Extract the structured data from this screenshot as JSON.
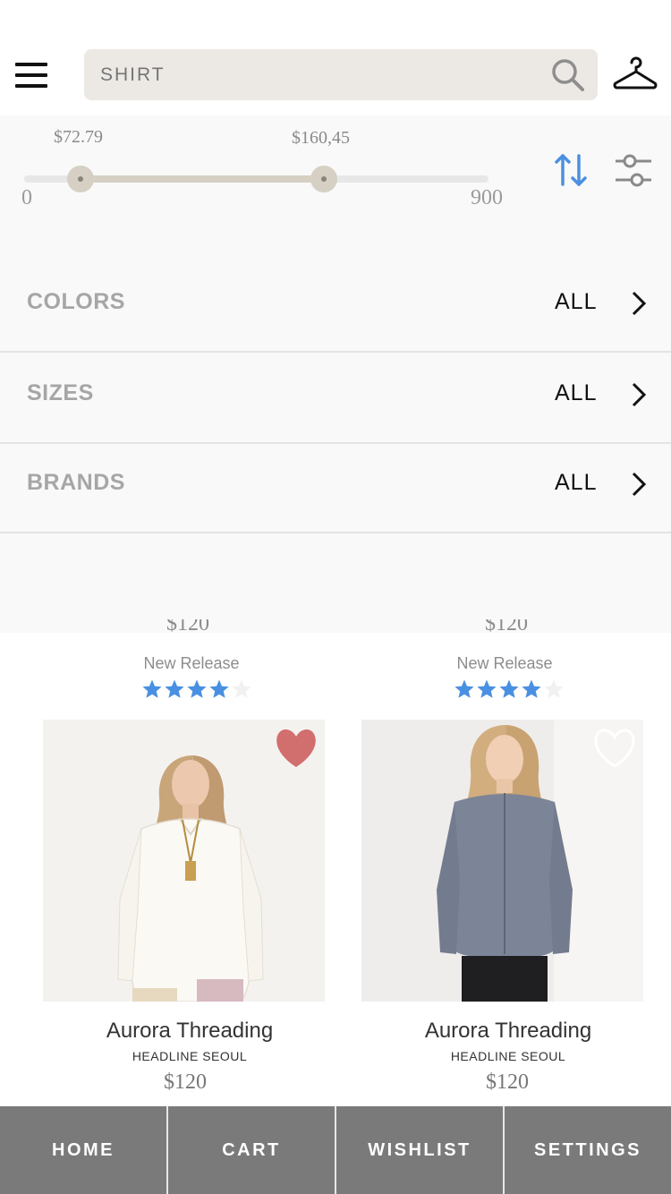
{
  "search": {
    "placeholder": "SHIRT"
  },
  "price_filter": {
    "selected_min": "$72.79",
    "selected_max": "$160,45",
    "range_min": "0",
    "range_max": "900",
    "selected_min_value": 72.79,
    "selected_max_value": 160.45,
    "range_min_value": 0,
    "range_max_value": 900
  },
  "filters": [
    {
      "label": "COLORS",
      "value": "ALL"
    },
    {
      "label": "SIZES",
      "value": "ALL"
    },
    {
      "label": "BRANDS",
      "value": "ALL"
    }
  ],
  "products_above": [
    {
      "price": "$120",
      "tag": "New Release",
      "rating": 4,
      "rating_max": 5
    },
    {
      "price": "$120",
      "tag": "New Release",
      "rating": 4,
      "rating_max": 5
    }
  ],
  "products": [
    {
      "title": "Aurora Threading",
      "brand": "HEADLINE SEOUL",
      "price": "$120",
      "wishlisted": true
    },
    {
      "title": "Aurora Threading",
      "brand": "HEADLINE SEOUL",
      "price": "$120",
      "wishlisted": false
    }
  ],
  "bottom_nav": [
    {
      "label": "HOME"
    },
    {
      "label": "CART"
    },
    {
      "label": "WISHLIST"
    },
    {
      "label": "SETTINGS"
    }
  ],
  "colors": {
    "accent_blue": "#4a90e2",
    "star_blue": "#4a90e2",
    "heart_red": "#d16e6e",
    "nav_bg": "#7a7a7a",
    "search_bg": "#ece9e5"
  },
  "icons": {
    "menu": "hamburger-menu-icon",
    "search": "search-icon",
    "hanger": "hanger-icon",
    "sort": "sort-arrows-icon",
    "adjust": "sliders-adjust-icon",
    "chevron": "chevron-right-icon",
    "heart": "heart-icon",
    "star": "star-icon"
  }
}
